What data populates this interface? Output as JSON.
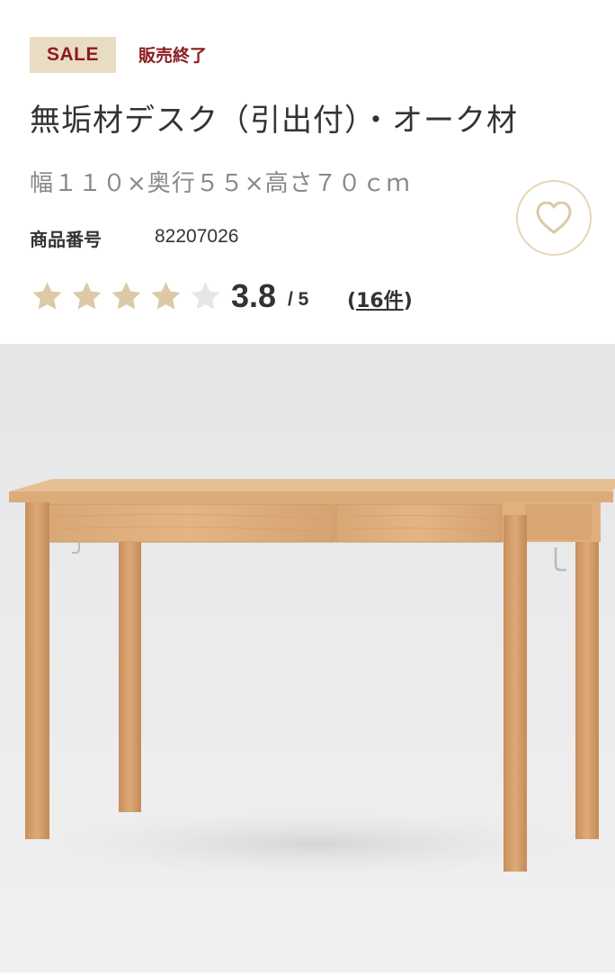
{
  "badge": {
    "sale_label": "SALE",
    "status": "販売終了"
  },
  "product": {
    "title": "無垢材デスク（引出付）・オーク材",
    "dimensions": "幅１１０×奥行５５×高さ７０ｃｍ",
    "product_number_label": "商品番号",
    "product_number": "82207026"
  },
  "rating": {
    "value": "3.8",
    "max": "/ 5",
    "stars_filled": 4,
    "stars_total": 5,
    "review_open": "(",
    "review_count": "16件",
    "review_close": ")"
  },
  "favorite": {
    "icon": "heart-icon"
  },
  "image": {
    "subject": "desk-photo"
  },
  "colors": {
    "sale_badge_bg": "#e9dcc5",
    "sale_text": "#8b1a1f",
    "star_filled": "#dcc9a6",
    "star_empty": "#e6e6e6",
    "heart": "#dcc9a6"
  }
}
